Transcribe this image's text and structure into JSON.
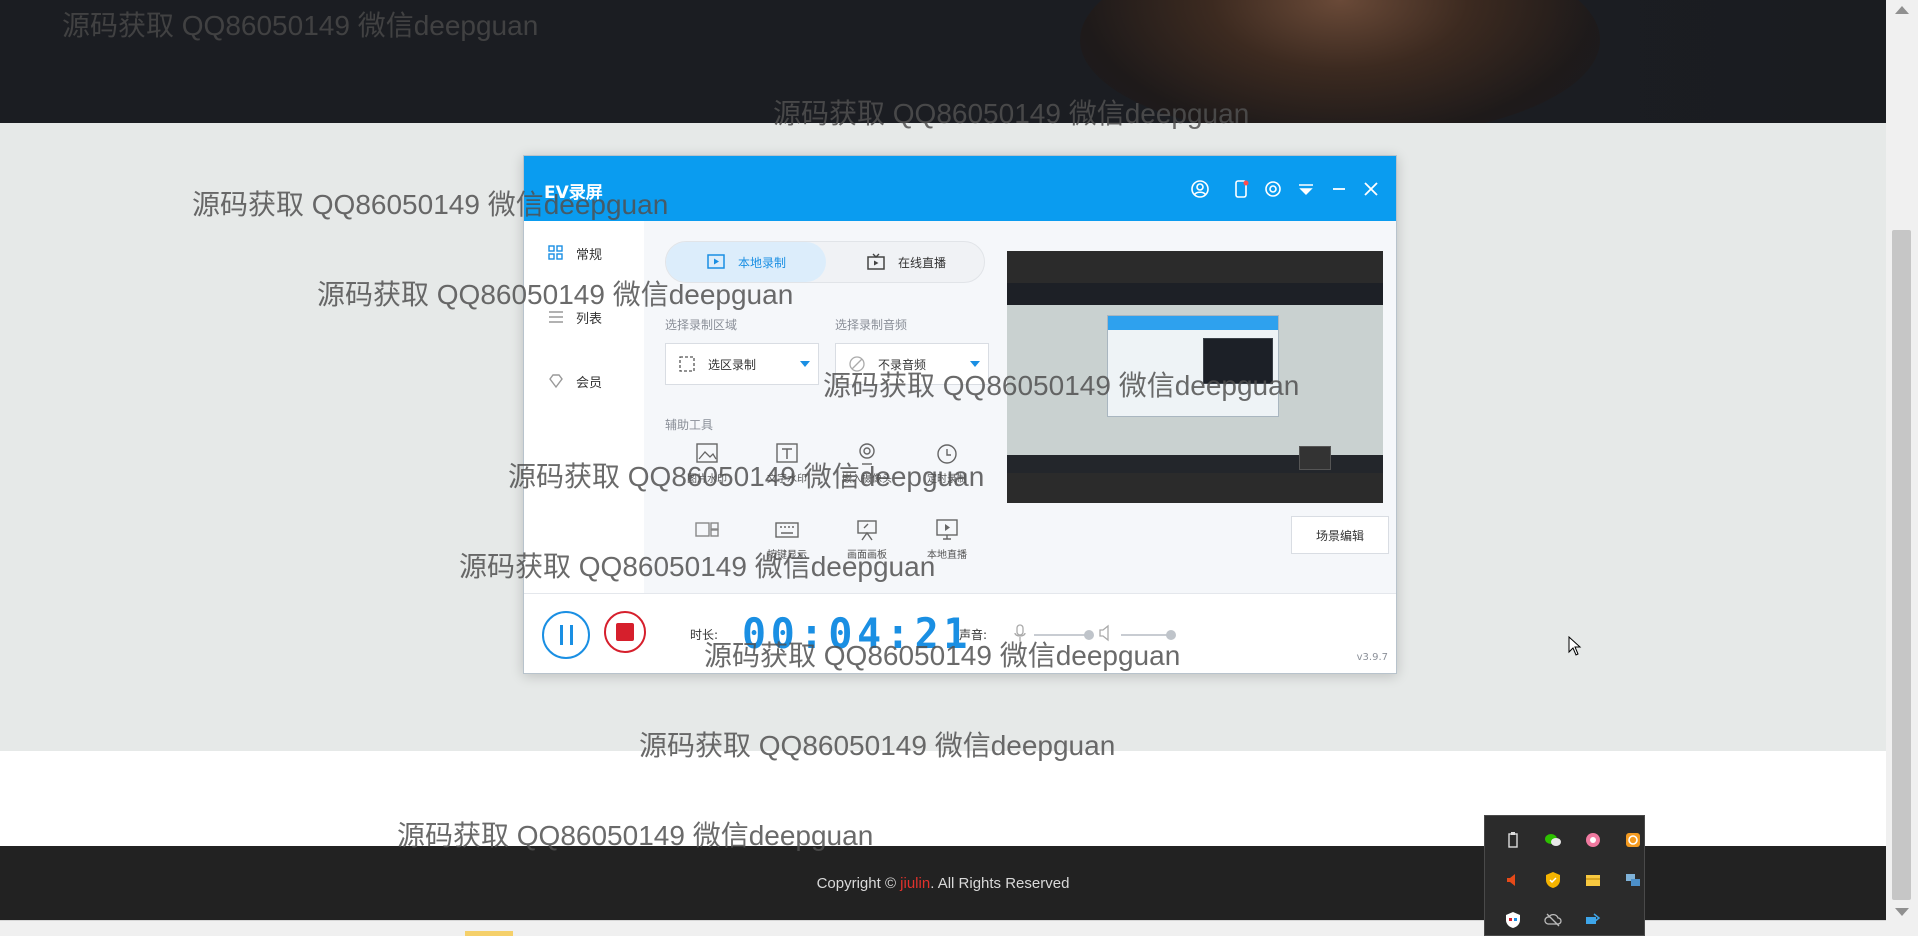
{
  "footer": {
    "copyright_prefix": "Copyright ©",
    "brand": "jiulin",
    "suffix": ". All Rights Reserved"
  },
  "watermark": "源码获取 QQ86050149 微信deepguan",
  "ev_window": {
    "title": "EV录屏",
    "title_icons": [
      "user-icon",
      "phone-icon",
      "settings-icon",
      "dropdown-icon",
      "minimize-icon",
      "close-icon"
    ],
    "sidebar": [
      {
        "label": "常规",
        "icon": "grid-icon"
      },
      {
        "label": "列表",
        "icon": "list-icon"
      },
      {
        "label": "会员",
        "icon": "diamond-icon"
      }
    ],
    "mode_tabs": {
      "local": "本地录制",
      "live": "在线直播"
    },
    "region": {
      "label": "选择录制区域",
      "value": "选区录制"
    },
    "audio": {
      "label": "选择录制音频",
      "value": "不录音频"
    },
    "tools_label": "辅助工具",
    "tools": [
      {
        "label": "图片水印",
        "icon": "image-icon"
      },
      {
        "label": "文字水印",
        "icon": "text-icon"
      },
      {
        "label": "嵌入摄像头",
        "icon": "camera-icon"
      },
      {
        "label": "定时录制",
        "icon": "clock-icon"
      },
      {
        "label": "",
        "icon": "layout-icon"
      },
      {
        "label": "按键显示",
        "icon": "keyboard-icon"
      },
      {
        "label": "画面画板",
        "icon": "easel-icon"
      },
      {
        "label": "本地直播",
        "icon": "screen-play-icon"
      }
    ],
    "scene_button": "场景编辑",
    "duration_label": "时长:",
    "timer": "00:04:21",
    "volume_label": "声音:",
    "version": "v3.9.7",
    "colors": {
      "accent": "#0a9cf0",
      "stop": "#d61f2c"
    }
  },
  "tray_icons": [
    "usb-icon",
    "wechat-icon",
    "app-icon",
    "orange-app-icon",
    "volume-icon",
    "security-icon",
    "folder-icon",
    "network-icon",
    "shield-icon",
    "cloud-off-icon",
    "bluetooth-icon"
  ]
}
